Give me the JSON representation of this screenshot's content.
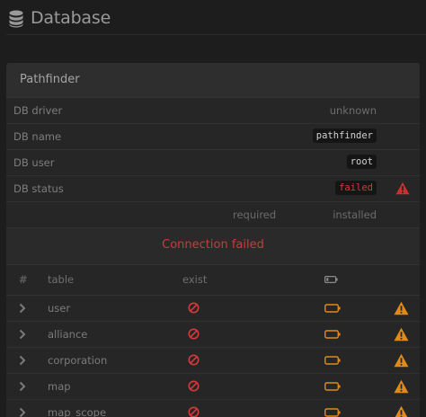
{
  "page": {
    "title": "Database"
  },
  "panel": {
    "title": "Pathfinder",
    "info_rows": [
      {
        "key": "DB driver",
        "value": "unknown"
      },
      {
        "key": "DB name",
        "value": "pathfinder"
      },
      {
        "key": "DB user",
        "value": "root"
      },
      {
        "key": "DB status",
        "value": "failed"
      }
    ],
    "version_header": {
      "required": "required",
      "installed": "installed"
    },
    "status_message": "Connection failed",
    "table_header": {
      "index": "#",
      "table": "table",
      "exist": "exist"
    },
    "tables": [
      {
        "name": "user"
      },
      {
        "name": "alliance"
      },
      {
        "name": "corporation"
      },
      {
        "name": "map"
      },
      {
        "name": "map_scope"
      }
    ]
  },
  "colors": {
    "error": "#d43a3a",
    "warning": "#e08a1e",
    "background": "#1d1d1d",
    "panel": "#262626"
  },
  "icons": {
    "header": "database-icon",
    "status": "warning-triangle-icon",
    "row_expand": "chevron-right-icon",
    "exist": "ban-icon",
    "state": "battery-empty-icon",
    "row_warning": "warning-triangle-icon"
  }
}
